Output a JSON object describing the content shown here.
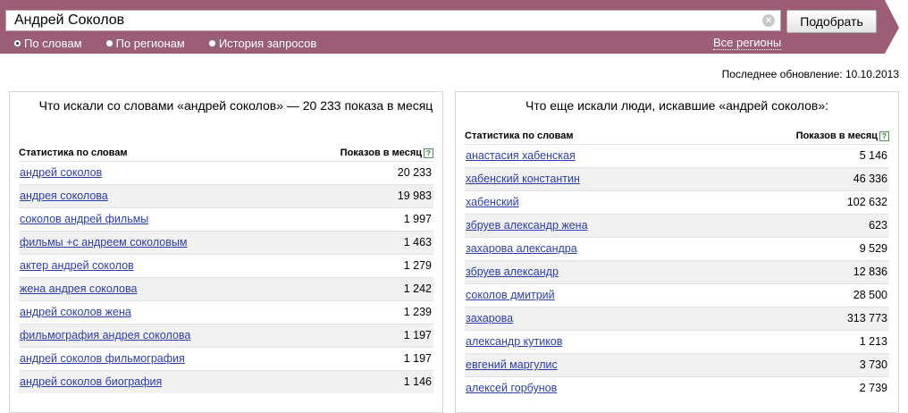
{
  "search": {
    "query": "Андрей Соколов",
    "clear_icon": "clear-x-icon",
    "submit_label": "Подобрать",
    "modes": [
      {
        "label": "По словам",
        "checked": true
      },
      {
        "label": "По регионам",
        "checked": false
      },
      {
        "label": "История запросов",
        "checked": false
      }
    ],
    "regions_label": "Все регионы"
  },
  "colors": {
    "accent": "#9b5e76",
    "link": "#2b3ea8",
    "row_alt": "#f1f1f1"
  },
  "updated": "Последнее обновление: 10.10.2013",
  "left": {
    "title": "Что искали со словами «андрей соколов» — 20 233 показа в месяц",
    "col_keyword": "Статистика по словам",
    "col_count": "Показов в месяц",
    "rows": [
      {
        "keyword": "андрей соколов",
        "count": "20 233"
      },
      {
        "keyword": "андрея соколова",
        "count": "19 983"
      },
      {
        "keyword": "соколов андрей фильмы",
        "count": "1 997"
      },
      {
        "keyword": "фильмы +с андреем соколовым",
        "count": "1 463"
      },
      {
        "keyword": "актер андрей соколов",
        "count": "1 279"
      },
      {
        "keyword": "жена андрея соколова",
        "count": "1 242"
      },
      {
        "keyword": "андрей соколов жена",
        "count": "1 239"
      },
      {
        "keyword": "фильмография андрея соколова",
        "count": "1 197"
      },
      {
        "keyword": "андрей соколов фильмография",
        "count": "1 197"
      },
      {
        "keyword": "андрей соколов биография",
        "count": "1 146"
      }
    ]
  },
  "right": {
    "title": "Что еще искали люди, искавшие «андрей соколов»:",
    "col_keyword": "Статистика по словам",
    "col_count": "Показов в месяц",
    "rows": [
      {
        "keyword": "анастасия хабенская",
        "count": "5 146"
      },
      {
        "keyword": "хабенский константин",
        "count": "46 336"
      },
      {
        "keyword": "хабенский",
        "count": "102 632"
      },
      {
        "keyword": "збруев александр жена",
        "count": "623"
      },
      {
        "keyword": "захарова александра",
        "count": "9 529"
      },
      {
        "keyword": "збруев александр",
        "count": "12 836"
      },
      {
        "keyword": "соколов дмитрий",
        "count": "28 500"
      },
      {
        "keyword": "захарова",
        "count": "313 773"
      },
      {
        "keyword": "александр кутиков",
        "count": "1 213"
      },
      {
        "keyword": "евгений маргулис",
        "count": "3 730"
      },
      {
        "keyword": "алексей горбунов",
        "count": "2 739"
      }
    ]
  }
}
